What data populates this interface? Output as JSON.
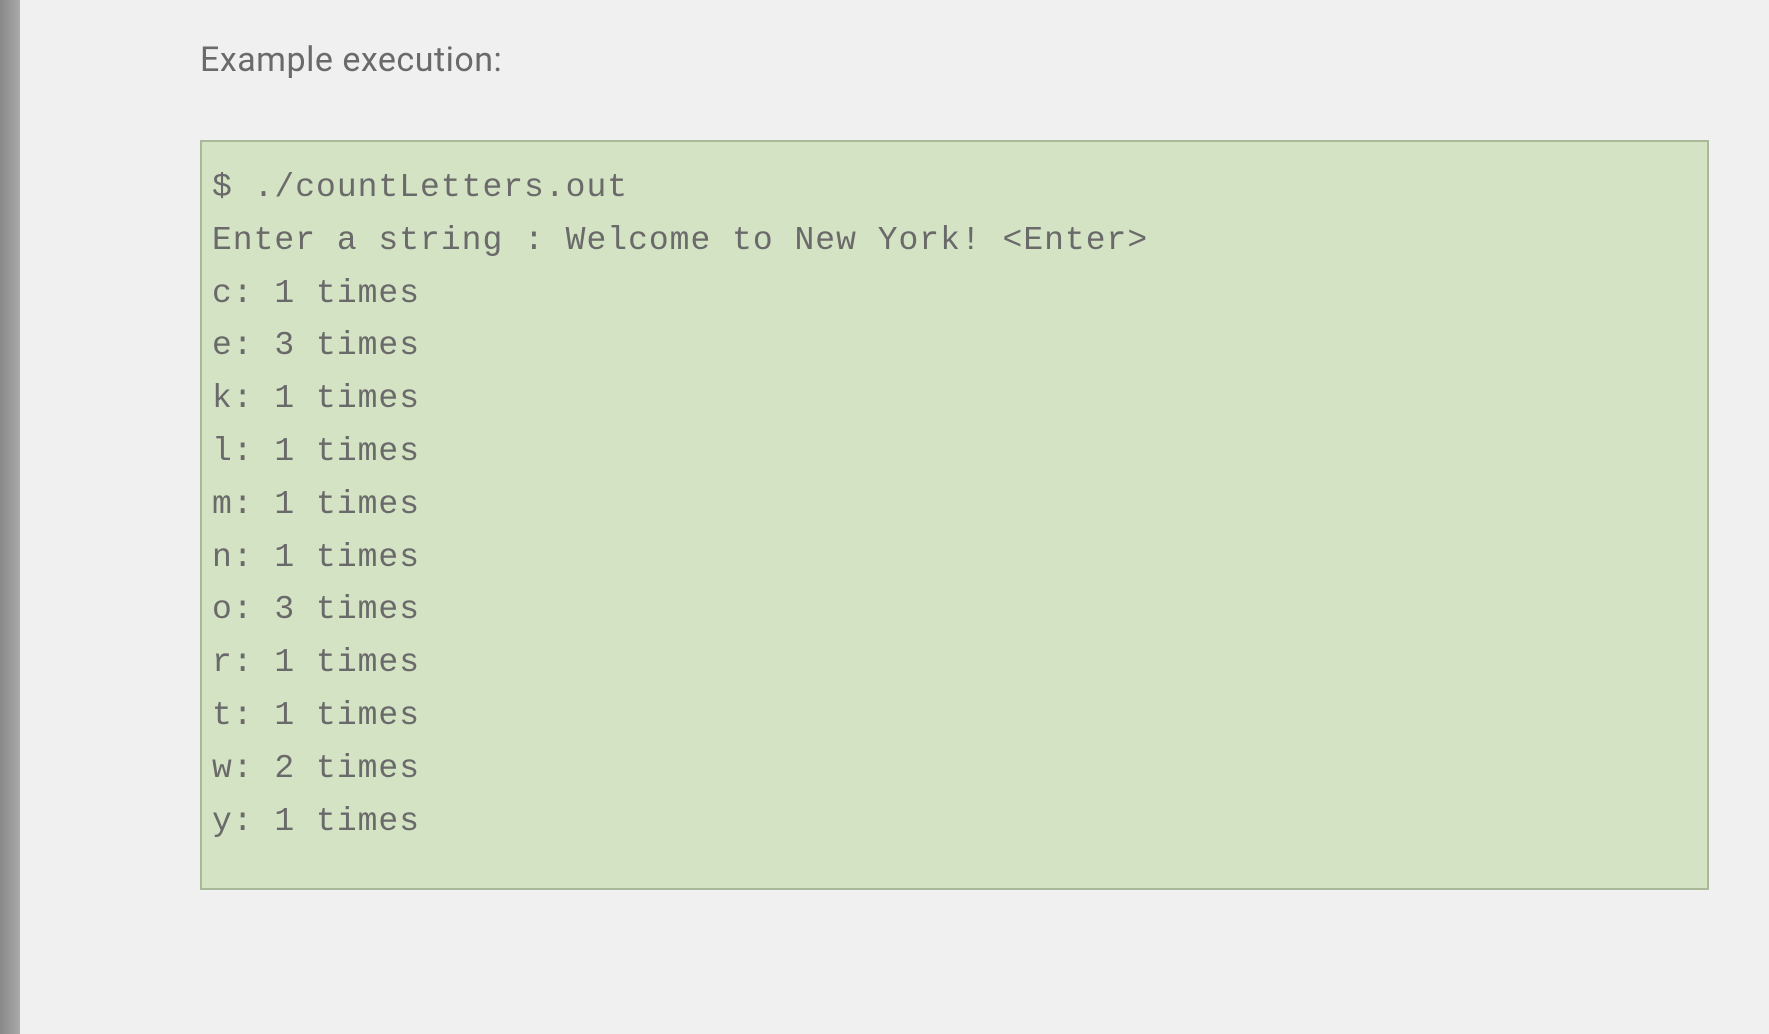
{
  "heading": "Example execution:",
  "code": {
    "command": "$ ./countLetters.out",
    "prompt": "Enter a string : Welcome to New York! <Enter>",
    "results": [
      "c: 1 times",
      "e: 3 times",
      "k: 1 times",
      "l: 1 times",
      "m: 1 times",
      "n: 1 times",
      "o: 3 times",
      "r: 1 times",
      "t: 1 times",
      "w: 2 times",
      "y: 1 times"
    ]
  }
}
